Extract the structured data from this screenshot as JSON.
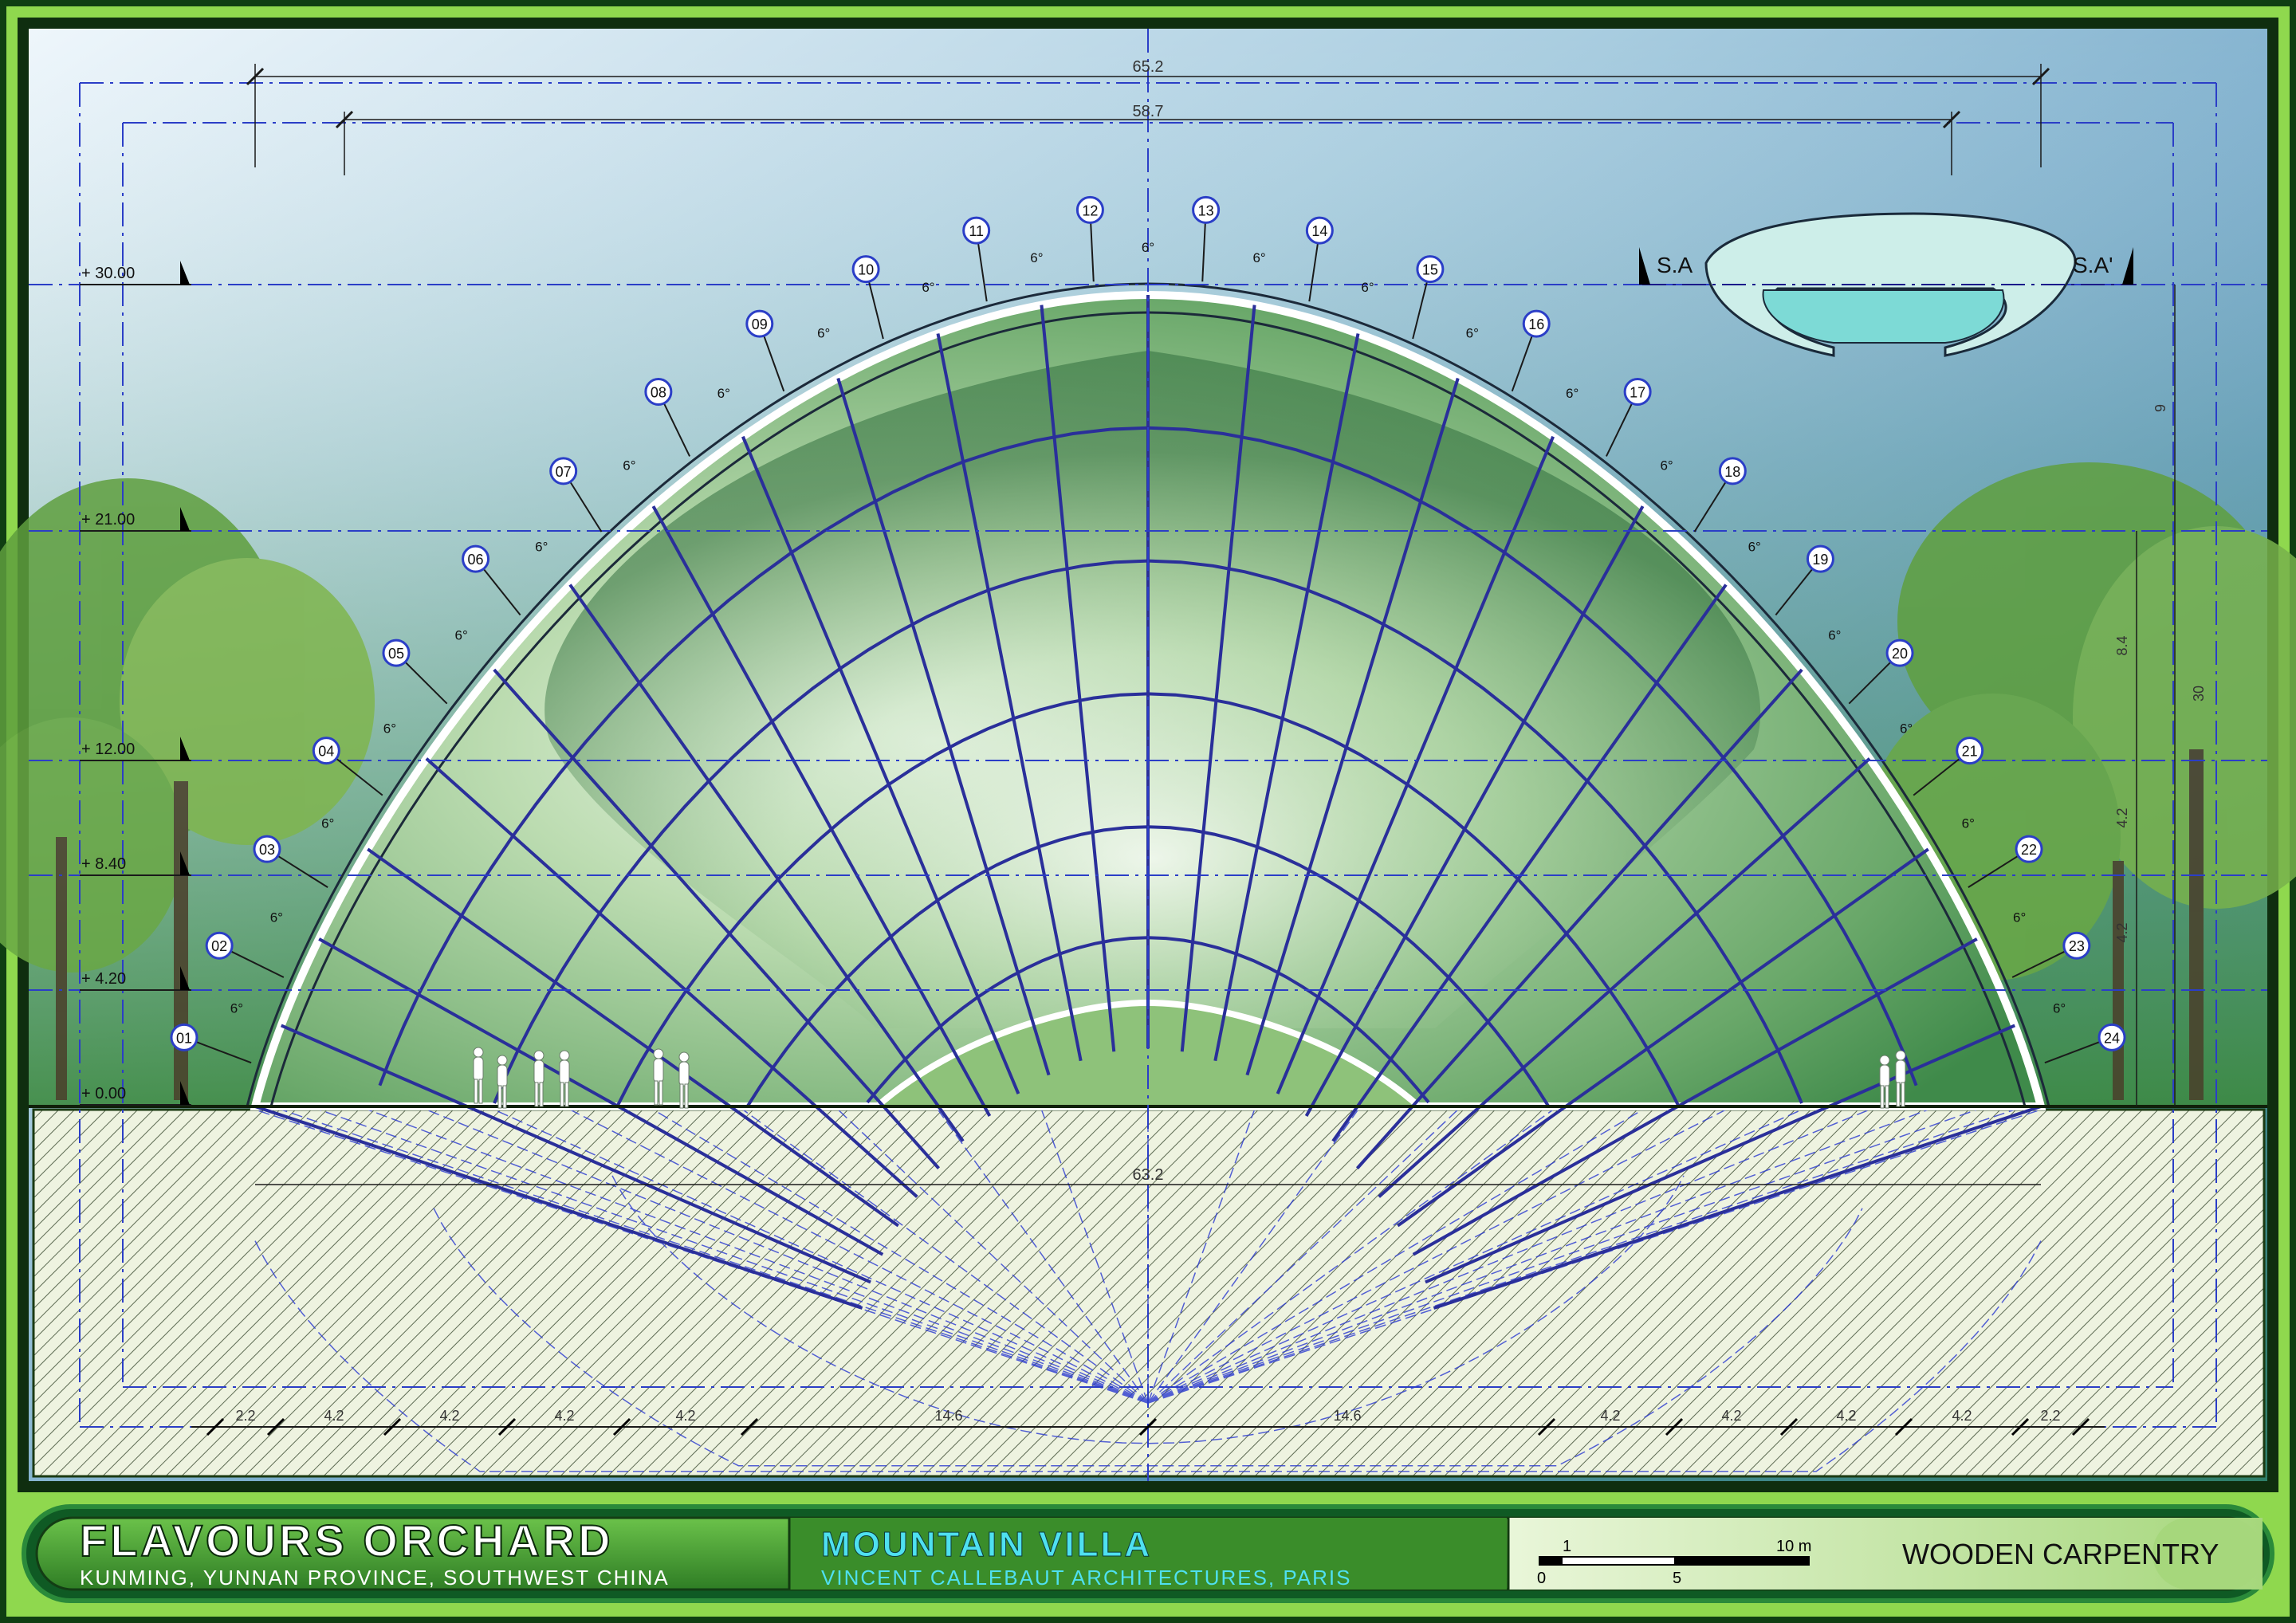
{
  "drawing": {
    "dimensions": {
      "overall_top": "65.2",
      "inner_top": "58.7",
      "ground_span": "63.2",
      "right_height_total": "9",
      "right_mid": "8.4",
      "right_low": "4.2",
      "right_low2": "4.2",
      "right_vertical": "30"
    },
    "levels": [
      "+ 30.00",
      "+ 21.00",
      "+ 12.00",
      "+ 8.40",
      "+ 4.20",
      "+ 0.00"
    ],
    "rib_markers": [
      "01",
      "02",
      "03",
      "04",
      "05",
      "06",
      "07",
      "08",
      "09",
      "10",
      "11",
      "12",
      "13",
      "14",
      "15",
      "16",
      "17",
      "18",
      "19",
      "20",
      "21",
      "22",
      "23",
      "24"
    ],
    "angle_label": "6°",
    "bottom_dims": [
      "2.2",
      "4.2",
      "4.2",
      "4.2",
      "4.2",
      "14.6",
      "14.6",
      "4.2",
      "4.2",
      "4.2",
      "4.2",
      "2.2"
    ],
    "section_labels": {
      "left": "S.A",
      "right": "S.A'"
    }
  },
  "title_bar": {
    "project_title": "FLAVOURS ORCHARD",
    "location": "KUNMING, YUNNAN PROVINCE, SOUTHWEST CHINA",
    "building": "MOUNTAIN VILLA",
    "architect": "VINCENT CALLEBAUT ARCHITECTURES, PARIS",
    "scale": {
      "top_left": "1",
      "top_right": "10 m",
      "bottom_left": "0",
      "bottom_mid": "5"
    },
    "drawing_type": "WOODEN CARPENTRY"
  }
}
